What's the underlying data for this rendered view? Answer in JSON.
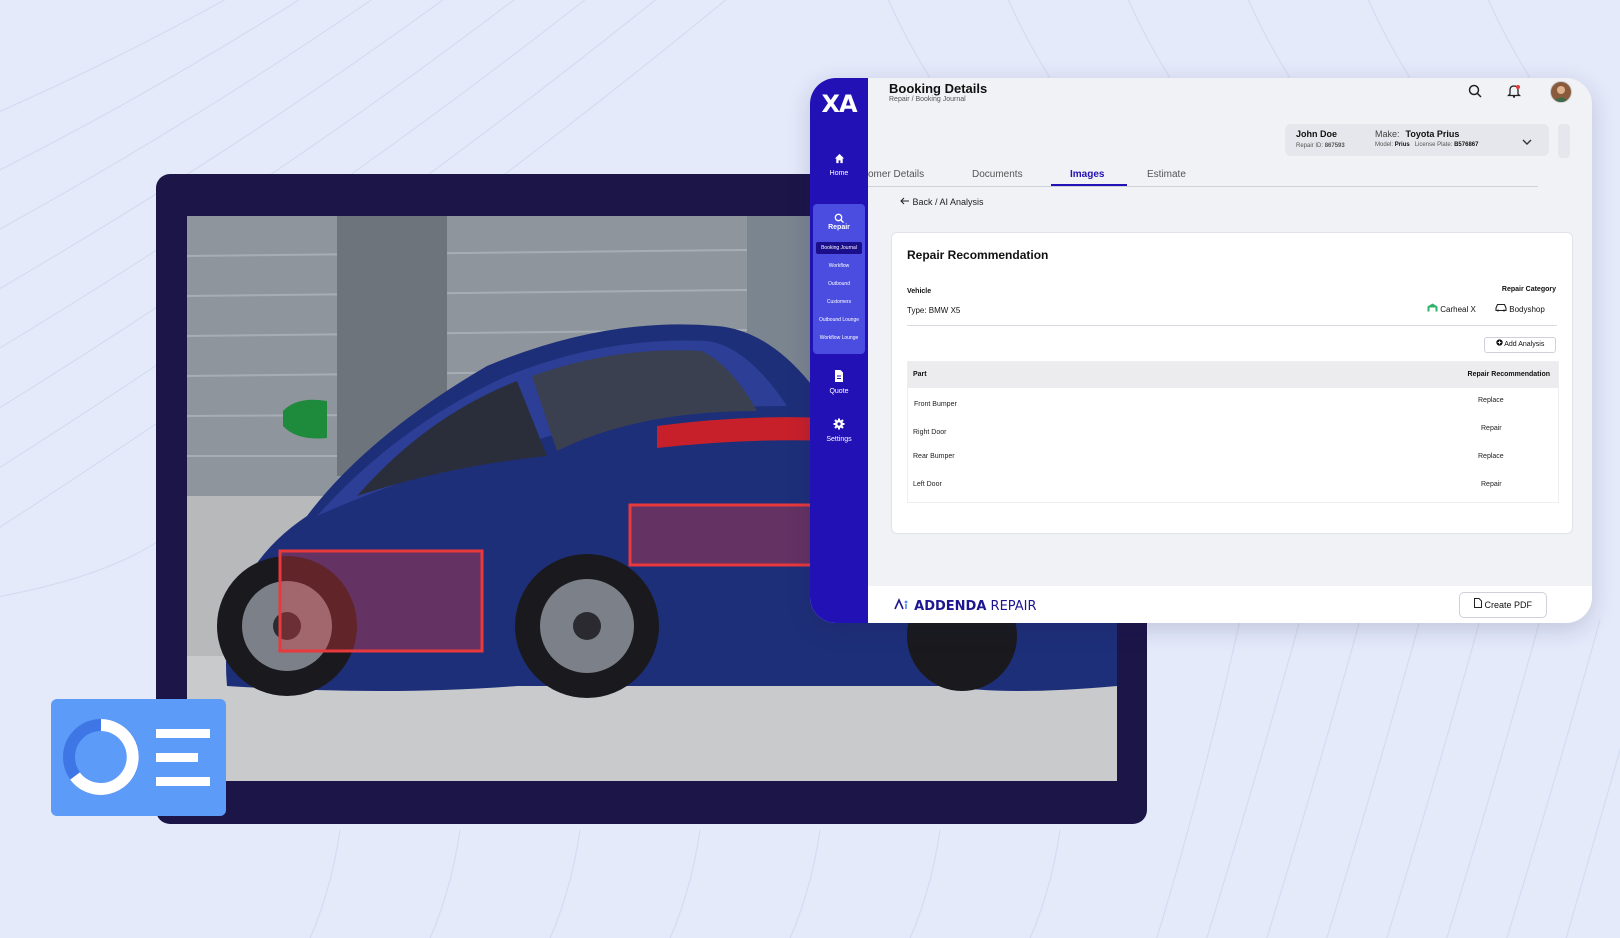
{
  "app": {
    "logo": "XA",
    "title": "Booking Details",
    "breadcrumb": "Repair / Booking Journal"
  },
  "sidebar": {
    "home": "Home",
    "repair": "Repair",
    "sub_items": [
      "Booking Journal",
      "Workflow",
      "Outbound",
      "Customers",
      "Outbound Lounge",
      "Workflow Lounge"
    ],
    "quote": "Quote",
    "settings": "Settings"
  },
  "customer": {
    "name": "John Doe",
    "repair_id_label": "Repair ID:",
    "repair_id": "867593",
    "make_label": "Make:",
    "make": "Toyota Prius",
    "model_label": "Model:",
    "model": "Prius",
    "plate_label": "License Plate:",
    "plate": "B576867"
  },
  "tabs": [
    "omer Details",
    "Documents",
    "Images",
    "Estimate"
  ],
  "active_tab": "Images",
  "back_link": "Back / AI  Analysis",
  "panel": {
    "title": "Repair Recommendation",
    "vehicle_label": "Vehicle",
    "vehicle_type": "Type: BMW X5",
    "category_label": "Repair Category",
    "category_a": "Carheal X",
    "category_b": "Bodyshop",
    "add_button": "Add Analysis",
    "table": {
      "headers": [
        "Part",
        "Repair Recommendation"
      ],
      "rows": [
        {
          "part": "Front Bumper",
          "rec": "Replace"
        },
        {
          "part": "Right Door",
          "rec": "Repair"
        },
        {
          "part": "Rear Bumper",
          "rec": "Replace"
        },
        {
          "part": "Left Door",
          "rec": "Repair"
        }
      ]
    }
  },
  "footer": {
    "brand_bold": "ADDENDA",
    "brand_rest": " REPAIR",
    "pdf_button": "Create PDF"
  },
  "colors": {
    "accent": "#2211b5",
    "background": "#e4eafa",
    "frame": "#1c1548",
    "damage_box": "#e8393d"
  },
  "icons": [
    "home-icon",
    "repair-icon",
    "quote-icon",
    "settings-icon",
    "search-icon",
    "bell-icon",
    "chevron-down-icon",
    "arrow-left-icon",
    "plus-circle-icon",
    "garage-icon",
    "car-icon",
    "document-icon"
  ]
}
